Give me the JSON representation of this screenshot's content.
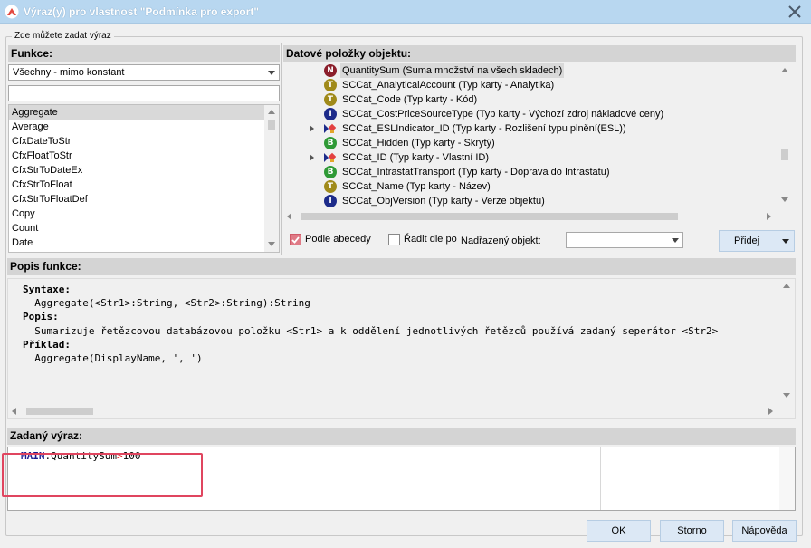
{
  "window": {
    "title": "Výraz(y) pro vlastnost \"Podmínka pro export\""
  },
  "group": {
    "legend": "Zde můžete zadat výraz"
  },
  "functions": {
    "header": "Funkce:",
    "filter_value": "Všechny - mimo konstant",
    "search_value": "",
    "items": [
      "Aggregate",
      "Average",
      "CfxDateToStr",
      "CfxFloatToStr",
      "CfxStrToDateEx",
      "CfxStrToFloat",
      "CfxStrToFloatDef",
      "Copy",
      "Count",
      "Date"
    ],
    "selected": "Aggregate"
  },
  "data_items": {
    "header": "Datové položky objektu:",
    "rows": [
      {
        "icon": "N",
        "label": "QuantitySum (Suma množství na všech skladech)",
        "expandable": false,
        "selected": true
      },
      {
        "icon": "T",
        "label": "SCCat_AnalyticalAccount (Typ karty - Analytika)",
        "expandable": false,
        "selected": false
      },
      {
        "icon": "T",
        "label": "SCCat_Code (Typ karty - Kód)",
        "expandable": false,
        "selected": false
      },
      {
        "icon": "I",
        "label": "SCCat_CostPriceSourceType (Typ karty - Výchozí zdroj nákladové ceny)",
        "expandable": false,
        "selected": false
      },
      {
        "icon": "link",
        "label": "SCCat_ESLIndicator_ID (Typ karty - Rozlišení typu plnění(ESL))",
        "expandable": true,
        "selected": false
      },
      {
        "icon": "B",
        "label": "SCCat_Hidden (Typ karty - Skrytý)",
        "expandable": false,
        "selected": false
      },
      {
        "icon": "link",
        "label": "SCCat_ID (Typ karty - Vlastní ID)",
        "expandable": true,
        "selected": false
      },
      {
        "icon": "B",
        "label": "SCCat_IntrastatTransport (Typ karty - Doprava do Intrastatu)",
        "expandable": false,
        "selected": false
      },
      {
        "icon": "T",
        "label": "SCCat_Name (Typ karty - Název)",
        "expandable": false,
        "selected": false
      },
      {
        "icon": "I",
        "label": "SCCat_ObjVersion (Typ karty - Verze objektu)",
        "expandable": false,
        "selected": false
      }
    ],
    "icon_colors": {
      "N": "#8b1e2b",
      "T": "#a08a1a",
      "I": "#1d2b8a",
      "B": "#2f9a36"
    },
    "sort_alpha_label": "Podle abecedy",
    "sort_alpha_checked": true,
    "sort_by_label": "Řadit dle po",
    "sort_by_checked": false,
    "parent_label": "Nadřazený objekt:",
    "parent_value": "",
    "add_button": "Přidej"
  },
  "description": {
    "header": "Popis funkce:",
    "lines": [
      "Syntaxe:",
      "  Aggregate(<Str1>:String, <Str2>:String):String",
      "Popis:",
      "  Sumarizuje řetězcovou databázovou položku <Str1> a k oddělení jednotlivých řetězců používá zadaný seperátor <Str2>",
      "Příklad:",
      "  Aggregate(DisplayName, ', ')"
    ]
  },
  "expression": {
    "header": "Zadaný výraz:",
    "object": "MAIN",
    "dot": ".",
    "field": "QuantitySum",
    "operator": ">",
    "value": "100"
  },
  "buttons": {
    "ok": "OK",
    "cancel": "Storno",
    "help": "Nápověda"
  },
  "colors": {
    "titlebar": "#b8d7f0",
    "highlight": "#e0455f",
    "button": "#dce8f5"
  }
}
